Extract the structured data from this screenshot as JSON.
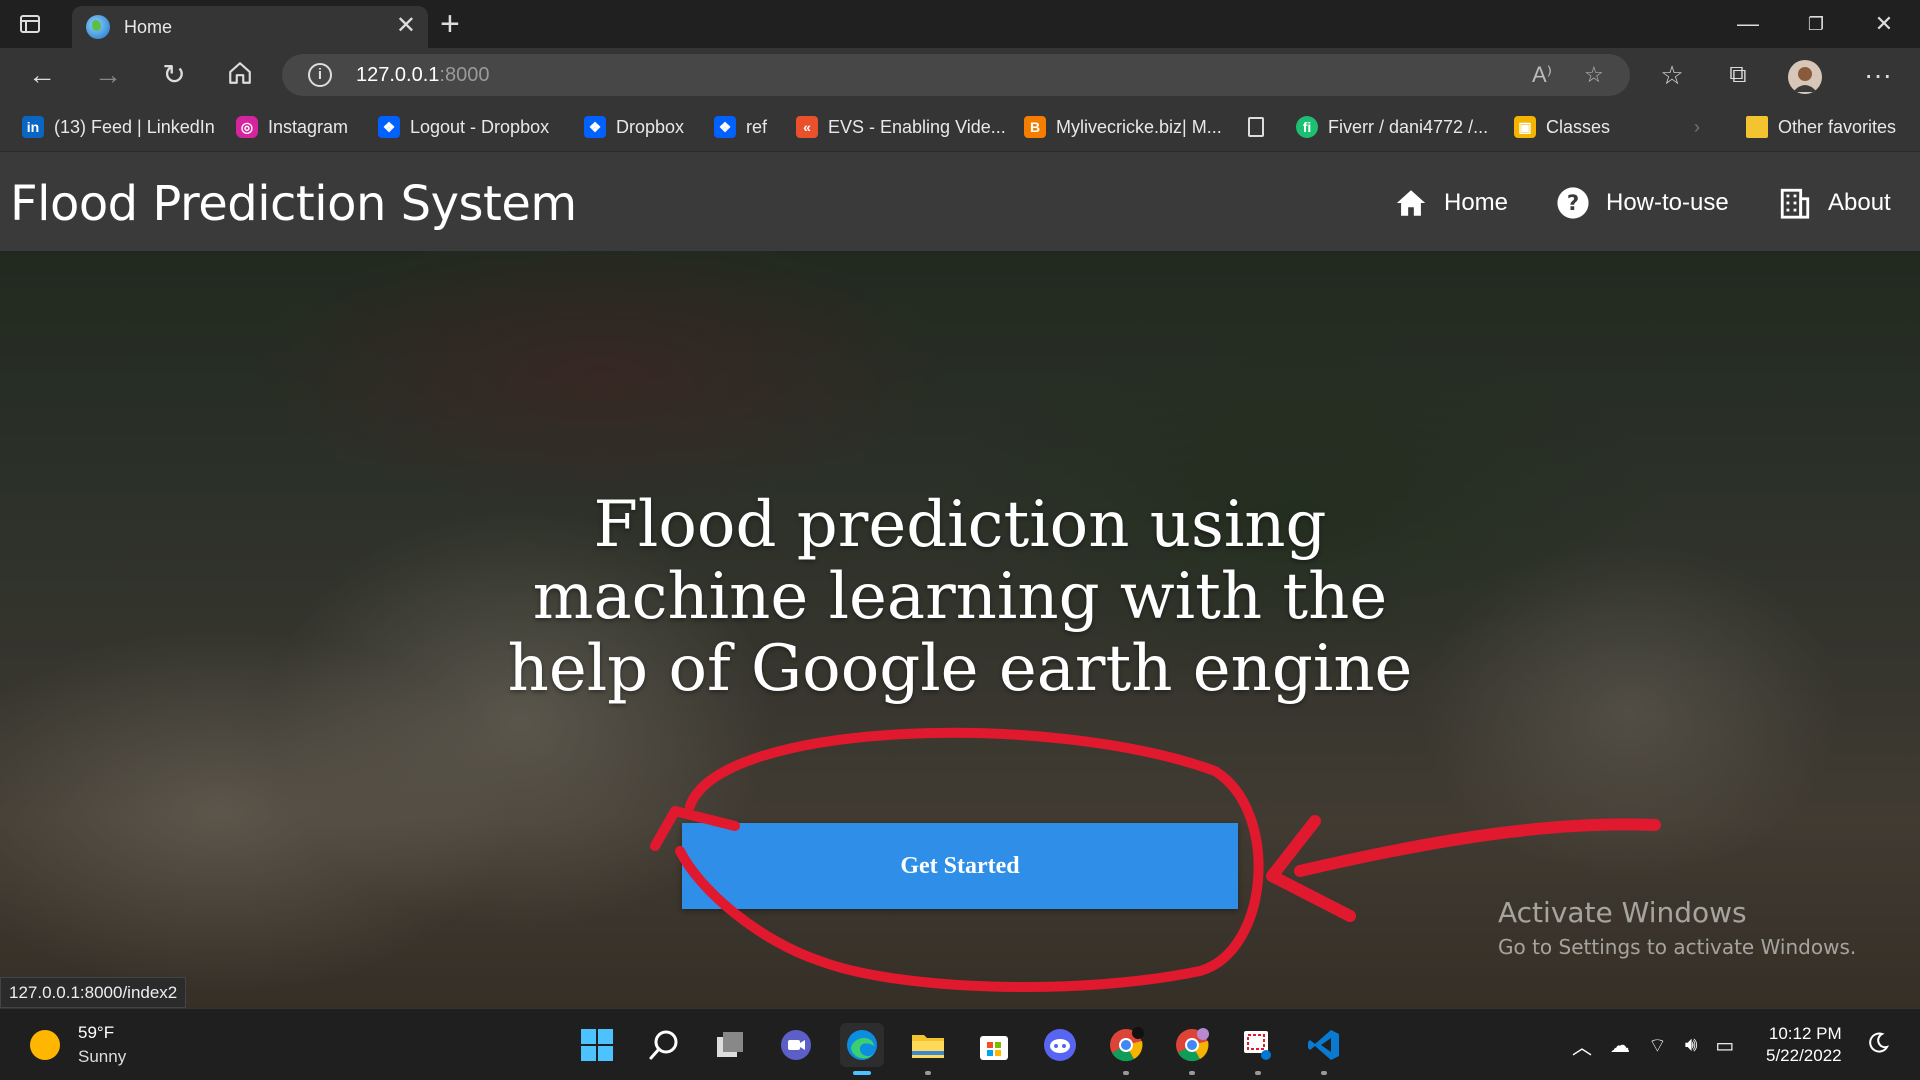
{
  "browser": {
    "tab_title": "Home",
    "url_host": "127.0.0.1",
    "url_port": ":8000",
    "favorites": [
      {
        "label": "(13) Feed | LinkedIn",
        "icon": "linkedin-icon",
        "color": "#0a66c2"
      },
      {
        "label": "Instagram",
        "icon": "instagram-icon",
        "color": "#d6249f"
      },
      {
        "label": "Logout - Dropbox",
        "icon": "dropbox-icon",
        "color": "#0061fe"
      },
      {
        "label": "Dropbox",
        "icon": "dropbox-icon",
        "color": "#0061fe"
      },
      {
        "label": "ref",
        "icon": "dropbox-icon",
        "color": "#0061fe"
      },
      {
        "label": "EVS - Enabling Vide...",
        "icon": "evs-icon",
        "color": "#e8512b"
      },
      {
        "label": "Mylivecricke.biz| M...",
        "icon": "blogger-icon",
        "color": "#f57d00"
      },
      {
        "label": "",
        "icon": "page-icon",
        "color": "#dddddd"
      },
      {
        "label": "Fiverr / dani4772 /...",
        "icon": "fiverr-icon",
        "color": "#1dbf73"
      },
      {
        "label": "Classes",
        "icon": "classroom-icon",
        "color": "#f4b400"
      }
    ],
    "other_favorites": "Other favorites"
  },
  "site": {
    "brand": "Flood Prediction System",
    "nav": [
      {
        "label": "Home",
        "icon": "home-icon"
      },
      {
        "label": "How-to-use",
        "icon": "question-circle-icon"
      },
      {
        "label": "About",
        "icon": "building-icon"
      }
    ]
  },
  "hero": {
    "headline": "Flood prediction using machine learning with the help of Google earth engine",
    "cta_label": "Get Started",
    "annotation_color": "#e0192e"
  },
  "watermark": {
    "line1": "Activate Windows",
    "line2": "Go to Settings to activate Windows."
  },
  "status_url": "127.0.0.1:8000/index2",
  "taskbar": {
    "temperature": "59°F",
    "condition": "Sunny",
    "time": "10:12 PM",
    "date": "5/22/2022",
    "apps": [
      "start-icon",
      "search-icon",
      "task-view-icon",
      "teams-chat-icon",
      "edge-icon",
      "file-explorer-icon",
      "store-icon",
      "discord-icon",
      "chrome-icon",
      "chrome-profile-icon",
      "snipping-tool-icon",
      "vscode-icon"
    ]
  }
}
